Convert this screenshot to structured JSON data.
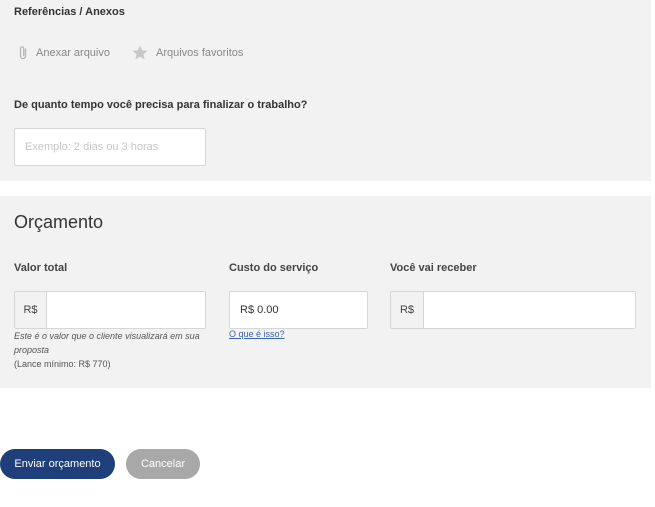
{
  "references": {
    "title": "Referências / Anexos",
    "attach_label": "Anexar arquivo",
    "favorites_label": "Arquivos favoritos"
  },
  "deadline": {
    "question": "De quanto tempo você precisa para finalizar o trabalho?",
    "placeholder": "Exemplo: 2 dias ou 3 horas",
    "value": ""
  },
  "budget": {
    "title": "Orçamento",
    "total": {
      "label": "Valor total",
      "prefix": "R$",
      "value": "",
      "hint": "Este é o valor que o cliente visualizará em sua proposta",
      "min_bid": "(Lance mínimo: R$ 770)"
    },
    "service_cost": {
      "label": "Custo do serviço",
      "value": "R$ 0.00",
      "link": "O que é isso?"
    },
    "receive": {
      "label": "Você vai receber",
      "prefix": "R$",
      "value": ""
    }
  },
  "actions": {
    "submit_label": "Enviar orçamento",
    "cancel_label": "Cancelar"
  },
  "colors": {
    "primary": "#1f3f7a",
    "secondary": "#a8a8a8",
    "panel": "#f2f2f2",
    "link": "#3a64b0"
  }
}
